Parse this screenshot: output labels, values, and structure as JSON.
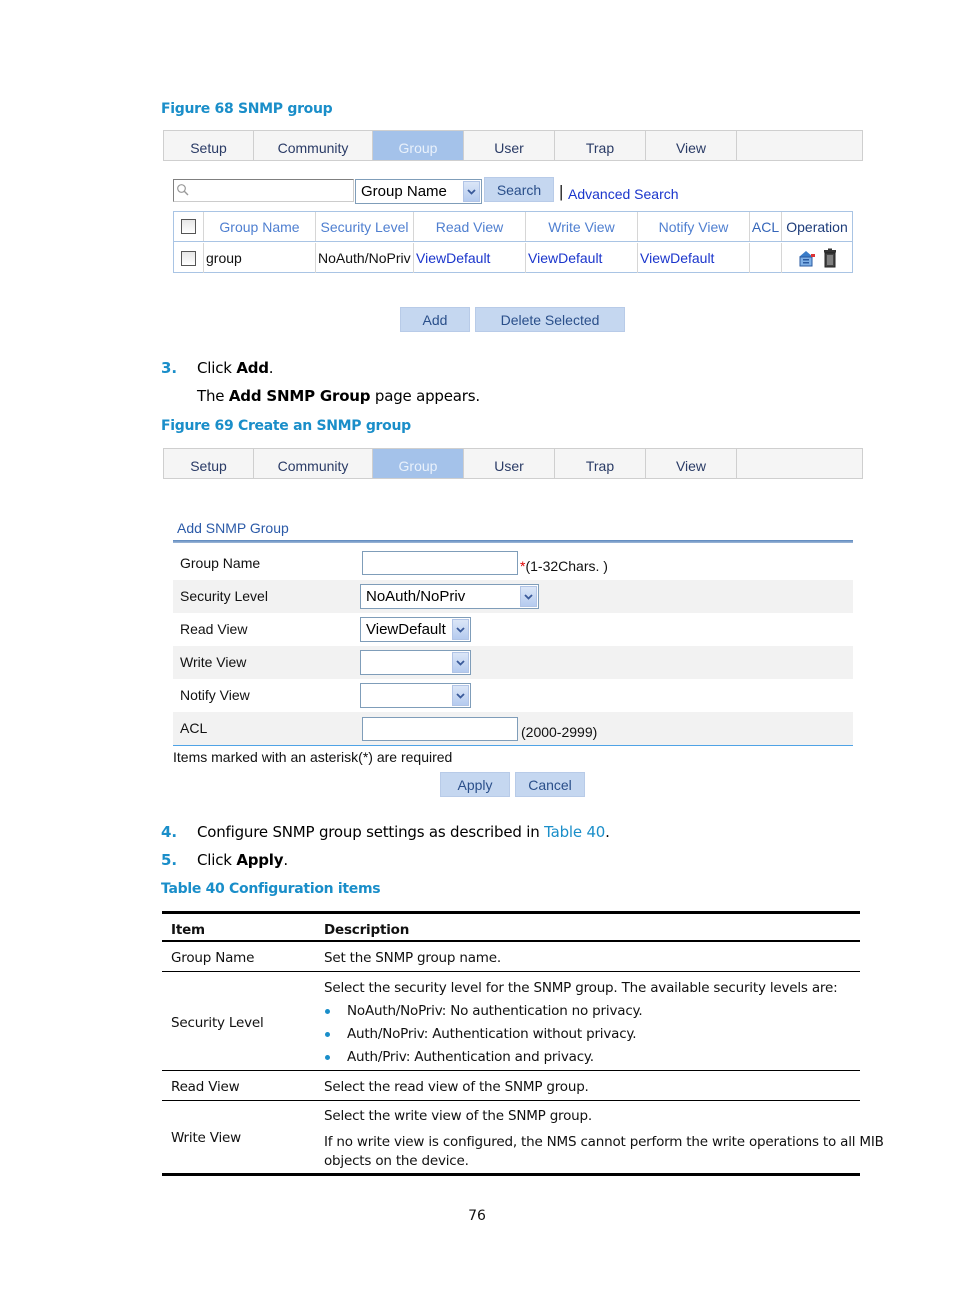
{
  "figure68": {
    "caption": "Figure 68 SNMP group",
    "tabs": [
      {
        "label": "Setup",
        "active": false
      },
      {
        "label": "Community",
        "active": false
      },
      {
        "label": "Group",
        "active": true
      },
      {
        "label": "User",
        "active": false
      },
      {
        "label": "Trap",
        "active": false
      },
      {
        "label": "View",
        "active": false
      }
    ],
    "search": {
      "input_value": "",
      "field_select": "Group Name",
      "search_button": "Search",
      "separator": "|",
      "advanced_link": "Advanced Search"
    },
    "table": {
      "headers": [
        "Group Name",
        "Security Level",
        "Read View",
        "Write View",
        "Notify View",
        "ACL",
        "Operation"
      ],
      "rows": [
        {
          "checked": false,
          "group_name": "group",
          "security_level": "NoAuth/NoPriv",
          "read_view": "ViewDefault",
          "write_view": "ViewDefault",
          "notify_view": "ViewDefault",
          "acl": "",
          "operations": [
            "edit-icon",
            "delete-icon"
          ]
        }
      ]
    },
    "buttons": {
      "add": "Add",
      "delete_selected": "Delete Selected"
    }
  },
  "steps": {
    "step3": {
      "num": "3.",
      "prefix": "Click ",
      "bold": "Add",
      "suffix": "."
    },
    "step3_note": {
      "prefix": "The ",
      "bold": "Add SNMP Group",
      "suffix": " page appears."
    },
    "step4": {
      "num": "4.",
      "prefix": "Configure SNMP group settings as described in ",
      "link": "Table 40",
      "suffix": "."
    },
    "step5": {
      "num": "5.",
      "prefix": "Click ",
      "bold": "Apply",
      "suffix": "."
    }
  },
  "figure69": {
    "caption": "Figure 69 Create an SNMP group",
    "tabs": [
      {
        "label": "Setup",
        "active": false
      },
      {
        "label": "Community",
        "active": false
      },
      {
        "label": "Group",
        "active": true
      },
      {
        "label": "User",
        "active": false
      },
      {
        "label": "Trap",
        "active": false
      },
      {
        "label": "View",
        "active": false
      }
    ],
    "form": {
      "title": "Add SNMP Group",
      "fields": {
        "group_name": {
          "label": "Group Name",
          "value": "",
          "required_mark": "*",
          "hint": "(1-32Chars. )"
        },
        "security_level": {
          "label": "Security Level",
          "value": "NoAuth/NoPriv"
        },
        "read_view": {
          "label": "Read View",
          "value": "ViewDefault"
        },
        "write_view": {
          "label": "Write View",
          "value": ""
        },
        "notify_view": {
          "label": "Notify View",
          "value": ""
        },
        "acl": {
          "label": "ACL",
          "value": "",
          "hint": "(2000-2999)"
        }
      },
      "required_note": "Items marked with an asterisk(*) are required",
      "apply": "Apply",
      "cancel": "Cancel"
    }
  },
  "table40": {
    "caption": "Table 40 Configuration items",
    "headers": [
      "Item",
      "Description"
    ],
    "rows": [
      {
        "item": "Group Name",
        "description": [
          "Set the SNMP group name."
        ]
      },
      {
        "item": "Security Level",
        "description": [
          "Select the security level for the SNMP group. The available security levels are:"
        ],
        "bullets": [
          "NoAuth/NoPriv: No authentication no privacy.",
          "Auth/NoPriv: Authentication without privacy.",
          "Auth/Priv: Authentication and privacy."
        ]
      },
      {
        "item": "Read View",
        "description": [
          "Select the read view of the SNMP group."
        ]
      },
      {
        "item": "Write View",
        "description": [
          "Select the write view of the SNMP group.",
          "If no write view is configured, the NMS cannot perform the write operations to all MIB",
          "objects on the device."
        ]
      }
    ]
  },
  "page_number": "76",
  "colors": {
    "accent": "#1a8ec9",
    "tab_active": "#a4c2ea",
    "button": "#c5d7f0",
    "link": "#1a35cc"
  }
}
